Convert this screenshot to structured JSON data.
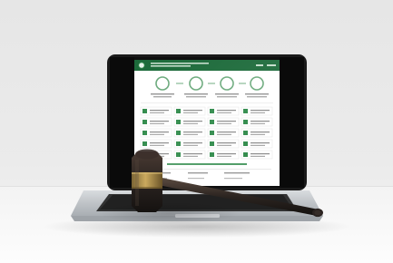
{
  "scene": {
    "subject": "laptop-with-gavel",
    "screen_ui": {
      "brand_color": "#2f8a4a",
      "header_color": "#1c6a3a",
      "step_count": 4,
      "tile_columns": 4,
      "tile_rows": 5
    }
  },
  "colors": {
    "background": "#e9e9e9",
    "table_top": "#f7f7f7",
    "laptop_shell": "#c2c5c9",
    "screen_frame": "#1a1a1a",
    "keyboard": "#2c2c2c",
    "gavel_wood": "#2a2320",
    "gavel_band": "#a78a4b"
  }
}
